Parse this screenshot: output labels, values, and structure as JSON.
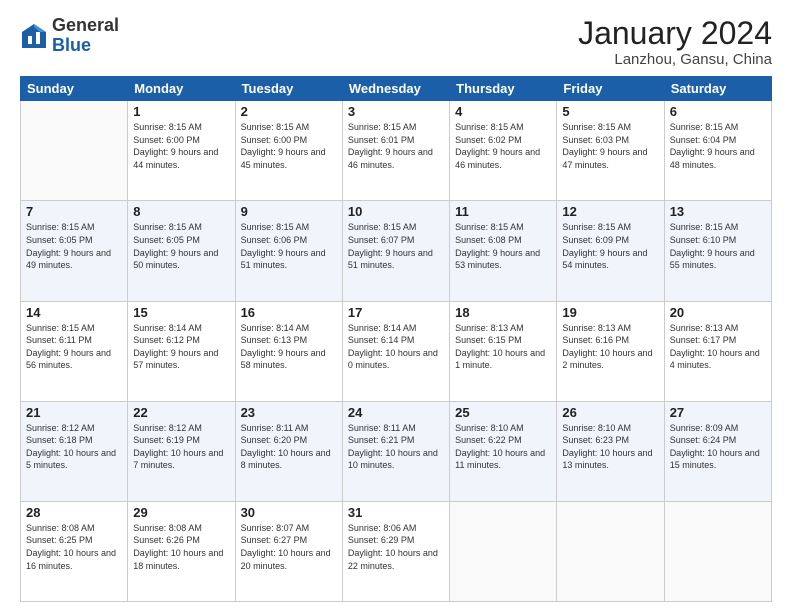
{
  "logo": {
    "general": "General",
    "blue": "Blue"
  },
  "header": {
    "title": "January 2024",
    "subtitle": "Lanzhou, Gansu, China"
  },
  "weekdays": [
    "Sunday",
    "Monday",
    "Tuesday",
    "Wednesday",
    "Thursday",
    "Friday",
    "Saturday"
  ],
  "weeks": [
    [
      {
        "day": "",
        "sunrise": "",
        "sunset": "",
        "daylight": ""
      },
      {
        "day": "1",
        "sunrise": "Sunrise: 8:15 AM",
        "sunset": "Sunset: 6:00 PM",
        "daylight": "Daylight: 9 hours and 44 minutes."
      },
      {
        "day": "2",
        "sunrise": "Sunrise: 8:15 AM",
        "sunset": "Sunset: 6:00 PM",
        "daylight": "Daylight: 9 hours and 45 minutes."
      },
      {
        "day": "3",
        "sunrise": "Sunrise: 8:15 AM",
        "sunset": "Sunset: 6:01 PM",
        "daylight": "Daylight: 9 hours and 46 minutes."
      },
      {
        "day": "4",
        "sunrise": "Sunrise: 8:15 AM",
        "sunset": "Sunset: 6:02 PM",
        "daylight": "Daylight: 9 hours and 46 minutes."
      },
      {
        "day": "5",
        "sunrise": "Sunrise: 8:15 AM",
        "sunset": "Sunset: 6:03 PM",
        "daylight": "Daylight: 9 hours and 47 minutes."
      },
      {
        "day": "6",
        "sunrise": "Sunrise: 8:15 AM",
        "sunset": "Sunset: 6:04 PM",
        "daylight": "Daylight: 9 hours and 48 minutes."
      }
    ],
    [
      {
        "day": "7",
        "sunrise": "Sunrise: 8:15 AM",
        "sunset": "Sunset: 6:05 PM",
        "daylight": "Daylight: 9 hours and 49 minutes."
      },
      {
        "day": "8",
        "sunrise": "Sunrise: 8:15 AM",
        "sunset": "Sunset: 6:05 PM",
        "daylight": "Daylight: 9 hours and 50 minutes."
      },
      {
        "day": "9",
        "sunrise": "Sunrise: 8:15 AM",
        "sunset": "Sunset: 6:06 PM",
        "daylight": "Daylight: 9 hours and 51 minutes."
      },
      {
        "day": "10",
        "sunrise": "Sunrise: 8:15 AM",
        "sunset": "Sunset: 6:07 PM",
        "daylight": "Daylight: 9 hours and 51 minutes."
      },
      {
        "day": "11",
        "sunrise": "Sunrise: 8:15 AM",
        "sunset": "Sunset: 6:08 PM",
        "daylight": "Daylight: 9 hours and 53 minutes."
      },
      {
        "day": "12",
        "sunrise": "Sunrise: 8:15 AM",
        "sunset": "Sunset: 6:09 PM",
        "daylight": "Daylight: 9 hours and 54 minutes."
      },
      {
        "day": "13",
        "sunrise": "Sunrise: 8:15 AM",
        "sunset": "Sunset: 6:10 PM",
        "daylight": "Daylight: 9 hours and 55 minutes."
      }
    ],
    [
      {
        "day": "14",
        "sunrise": "Sunrise: 8:15 AM",
        "sunset": "Sunset: 6:11 PM",
        "daylight": "Daylight: 9 hours and 56 minutes."
      },
      {
        "day": "15",
        "sunrise": "Sunrise: 8:14 AM",
        "sunset": "Sunset: 6:12 PM",
        "daylight": "Daylight: 9 hours and 57 minutes."
      },
      {
        "day": "16",
        "sunrise": "Sunrise: 8:14 AM",
        "sunset": "Sunset: 6:13 PM",
        "daylight": "Daylight: 9 hours and 58 minutes."
      },
      {
        "day": "17",
        "sunrise": "Sunrise: 8:14 AM",
        "sunset": "Sunset: 6:14 PM",
        "daylight": "Daylight: 10 hours and 0 minutes."
      },
      {
        "day": "18",
        "sunrise": "Sunrise: 8:13 AM",
        "sunset": "Sunset: 6:15 PM",
        "daylight": "Daylight: 10 hours and 1 minute."
      },
      {
        "day": "19",
        "sunrise": "Sunrise: 8:13 AM",
        "sunset": "Sunset: 6:16 PM",
        "daylight": "Daylight: 10 hours and 2 minutes."
      },
      {
        "day": "20",
        "sunrise": "Sunrise: 8:13 AM",
        "sunset": "Sunset: 6:17 PM",
        "daylight": "Daylight: 10 hours and 4 minutes."
      }
    ],
    [
      {
        "day": "21",
        "sunrise": "Sunrise: 8:12 AM",
        "sunset": "Sunset: 6:18 PM",
        "daylight": "Daylight: 10 hours and 5 minutes."
      },
      {
        "day": "22",
        "sunrise": "Sunrise: 8:12 AM",
        "sunset": "Sunset: 6:19 PM",
        "daylight": "Daylight: 10 hours and 7 minutes."
      },
      {
        "day": "23",
        "sunrise": "Sunrise: 8:11 AM",
        "sunset": "Sunset: 6:20 PM",
        "daylight": "Daylight: 10 hours and 8 minutes."
      },
      {
        "day": "24",
        "sunrise": "Sunrise: 8:11 AM",
        "sunset": "Sunset: 6:21 PM",
        "daylight": "Daylight: 10 hours and 10 minutes."
      },
      {
        "day": "25",
        "sunrise": "Sunrise: 8:10 AM",
        "sunset": "Sunset: 6:22 PM",
        "daylight": "Daylight: 10 hours and 11 minutes."
      },
      {
        "day": "26",
        "sunrise": "Sunrise: 8:10 AM",
        "sunset": "Sunset: 6:23 PM",
        "daylight": "Daylight: 10 hours and 13 minutes."
      },
      {
        "day": "27",
        "sunrise": "Sunrise: 8:09 AM",
        "sunset": "Sunset: 6:24 PM",
        "daylight": "Daylight: 10 hours and 15 minutes."
      }
    ],
    [
      {
        "day": "28",
        "sunrise": "Sunrise: 8:08 AM",
        "sunset": "Sunset: 6:25 PM",
        "daylight": "Daylight: 10 hours and 16 minutes."
      },
      {
        "day": "29",
        "sunrise": "Sunrise: 8:08 AM",
        "sunset": "Sunset: 6:26 PM",
        "daylight": "Daylight: 10 hours and 18 minutes."
      },
      {
        "day": "30",
        "sunrise": "Sunrise: 8:07 AM",
        "sunset": "Sunset: 6:27 PM",
        "daylight": "Daylight: 10 hours and 20 minutes."
      },
      {
        "day": "31",
        "sunrise": "Sunrise: 8:06 AM",
        "sunset": "Sunset: 6:29 PM",
        "daylight": "Daylight: 10 hours and 22 minutes."
      },
      {
        "day": "",
        "sunrise": "",
        "sunset": "",
        "daylight": ""
      },
      {
        "day": "",
        "sunrise": "",
        "sunset": "",
        "daylight": ""
      },
      {
        "day": "",
        "sunrise": "",
        "sunset": "",
        "daylight": ""
      }
    ]
  ]
}
